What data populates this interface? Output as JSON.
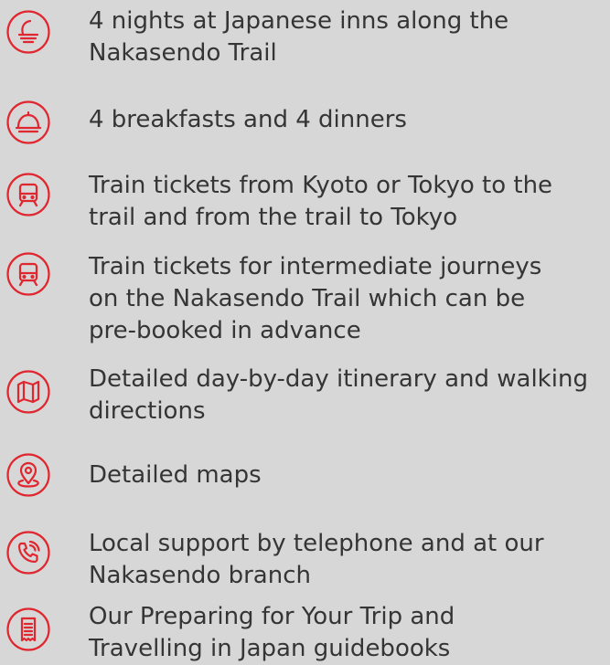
{
  "accent_color": "#e0262e",
  "text_color": "#353535",
  "background_color": "#d7d7d7",
  "inclusions": [
    {
      "icon": "moon-bed-icon",
      "text": "4 nights at Japanese inns along the\nNakasendo Trail"
    },
    {
      "icon": "food-cloche-icon",
      "text": "4 breakfasts and 4 dinners"
    },
    {
      "icon": "train-icon",
      "text": "Train tickets from Kyoto or Tokyo to the\ntrail and from the trail to Tokyo"
    },
    {
      "icon": "train-icon",
      "text": "Train tickets for intermediate journeys\non the Nakasendo Trail which can be\npre-booked in advance"
    },
    {
      "icon": "map-icon",
      "text": "Detailed day-by-day itinerary and walking\ndirections"
    },
    {
      "icon": "map-pin-icon",
      "text": "Detailed maps"
    },
    {
      "icon": "phone-icon",
      "text": "Local support by telephone and at our\nNakasendo branch"
    },
    {
      "icon": "guidebook-icon",
      "text": "Our Preparing for Your Trip and\nTravelling in Japan guidebooks"
    }
  ]
}
